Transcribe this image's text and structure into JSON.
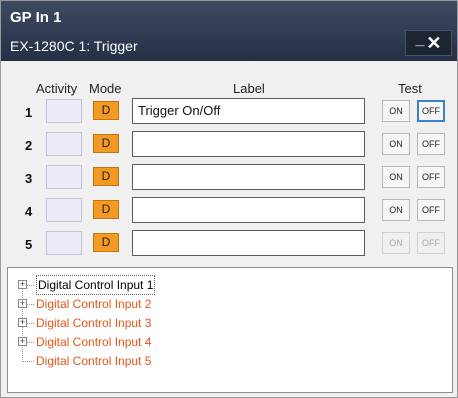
{
  "window": {
    "title": "GP In 1",
    "subtitle": "EX-1280C 1: Trigger",
    "minimize_glyph": "_",
    "close_glyph": "✕"
  },
  "headers": {
    "activity": "Activity",
    "mode": "Mode",
    "label": "Label",
    "test": "Test"
  },
  "rows": [
    {
      "num": "1",
      "mode": "D",
      "label": "Trigger On/Off",
      "on": "ON",
      "off": "OFF"
    },
    {
      "num": "2",
      "mode": "D",
      "label": "",
      "on": "ON",
      "off": "OFF"
    },
    {
      "num": "3",
      "mode": "D",
      "label": "",
      "on": "ON",
      "off": "OFF"
    },
    {
      "num": "4",
      "mode": "D",
      "label": "",
      "on": "ON",
      "off": "OFF"
    },
    {
      "num": "5",
      "mode": "D",
      "label": "",
      "on": "ON",
      "off": "OFF"
    }
  ],
  "tree": [
    {
      "label": "Digital Control Input 1",
      "expandable": true,
      "selected": true
    },
    {
      "label": "Digital Control Input 2",
      "expandable": true,
      "selected": false
    },
    {
      "label": "Digital Control Input 3",
      "expandable": true,
      "selected": false
    },
    {
      "label": "Digital Control Input 4",
      "expandable": true,
      "selected": false
    },
    {
      "label": "Digital Control Input 5",
      "expandable": false,
      "selected": false
    }
  ],
  "colors": {
    "titlebar": "#2d3850",
    "mode_button": "#f49a22",
    "tree_item_text": "#e2561a",
    "selected_border": "#3c7fd0"
  }
}
